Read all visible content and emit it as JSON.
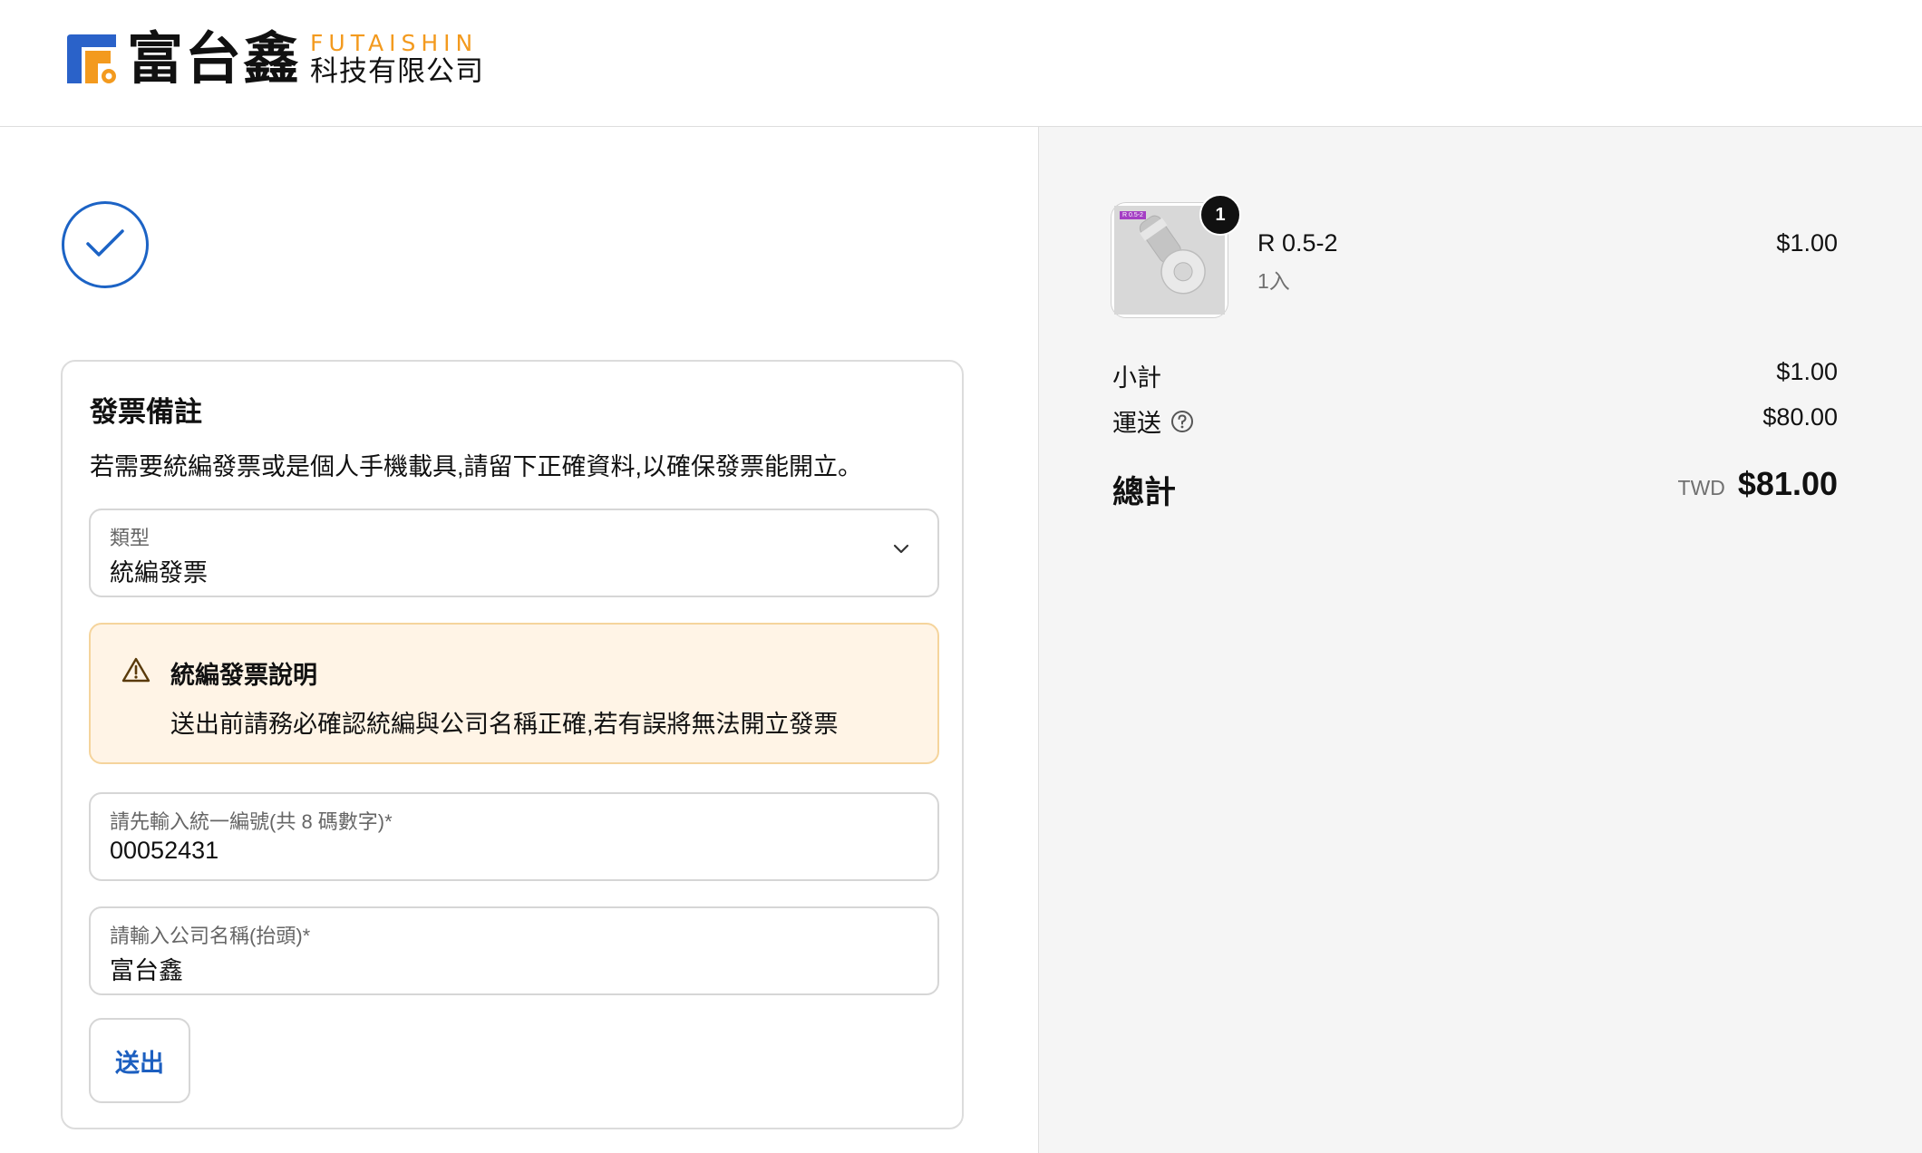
{
  "header": {
    "logo_cn": "富台鑫",
    "logo_en": "FUTAISHIN",
    "logo_sub": "科技有限公司"
  },
  "invoice": {
    "title": "發票備註",
    "description": "若需要統編發票或是個人手機載具,請留下正確資料,以確保發票能開立。",
    "type_label": "類型",
    "type_value": "統編發票",
    "notice_title": "統編發票說明",
    "notice_text": "送出前請務必確認統編與公司名稱正確,若有誤將無法開立發票",
    "tax_id_label": "請先輸入統一編號(共 8 碼數字)*",
    "tax_id_value": "00052431",
    "company_label": "請輸入公司名稱(抬頭)*",
    "company_value": "富台鑫",
    "submit_label": "送出"
  },
  "order": {
    "item": {
      "name": "R 0.5-2",
      "variant": "1入",
      "price": "$1.00",
      "quantity": "1",
      "image_tag": "R 0.5-2"
    },
    "subtotal_label": "小計",
    "subtotal_value": "$1.00",
    "shipping_label": "運送",
    "shipping_value": "$80.00",
    "total_label": "總計",
    "total_currency": "TWD",
    "total_value": "$81.00"
  },
  "colors": {
    "accent_blue": "#1c63c5",
    "brand_orange": "#f39a1e",
    "notice_bg": "#fff4e6",
    "notice_border": "#f5d49c",
    "summary_bg": "#f5f5f5"
  }
}
